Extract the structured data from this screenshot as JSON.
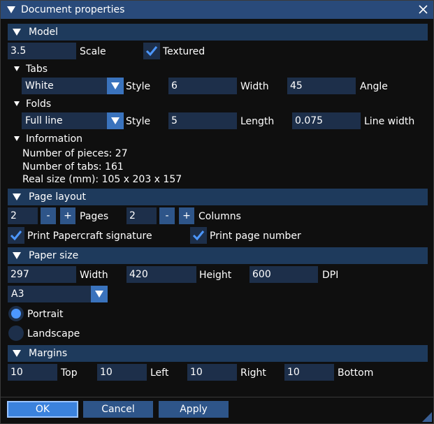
{
  "window": {
    "title": "Document properties"
  },
  "model": {
    "header": "Model",
    "scale_value": "3.5",
    "scale_label": "Scale",
    "textured_label": "Textured",
    "textured_checked": true,
    "tabs": {
      "header": "Tabs",
      "style_value": "White",
      "style_label": "Style",
      "width_value": "6",
      "width_label": "Width",
      "angle_value": "45",
      "angle_label": "Angle"
    },
    "folds": {
      "header": "Folds",
      "style_value": "Full line",
      "style_label": "Style",
      "length_value": "5",
      "length_label": "Length",
      "line_width_value": "0.075",
      "line_width_label": "Line width"
    },
    "information": {
      "header": "Information",
      "pieces": "Number of pieces: 27",
      "tabs": "Number of tabs: 161",
      "size": "Real size (mm): 105 x 203 x 157"
    }
  },
  "page_layout": {
    "header": "Page layout",
    "pages_value": "2",
    "pages_label": "Pages",
    "columns_value": "2",
    "columns_label": "Columns",
    "minus": "-",
    "plus": "+",
    "signature_label": "Print Papercraft signature",
    "signature_checked": true,
    "page_number_label": "Print page number",
    "page_number_checked": true
  },
  "paper_size": {
    "header": "Paper size",
    "width_value": "297",
    "width_label": "Width",
    "height_value": "420",
    "height_label": "Height",
    "dpi_value": "600",
    "dpi_label": "DPI",
    "size_value": "A3",
    "portrait_label": "Portrait",
    "landscape_label": "Landscape",
    "orientation": "portrait"
  },
  "margins": {
    "header": "Margins",
    "top_value": "10",
    "top_label": "Top",
    "left_value": "10",
    "left_label": "Left",
    "right_value": "10",
    "right_label": "Right",
    "bottom_value": "10",
    "bottom_label": "Bottom"
  },
  "buttons": {
    "ok": "OK",
    "cancel": "Cancel",
    "apply": "Apply"
  },
  "colors": {
    "title_bar": "#294a7a",
    "header_bg": "#1e3a5c",
    "field_bg": "#1d2f4a",
    "button_bg": "#2e5589",
    "accent": "#4c97ff"
  }
}
